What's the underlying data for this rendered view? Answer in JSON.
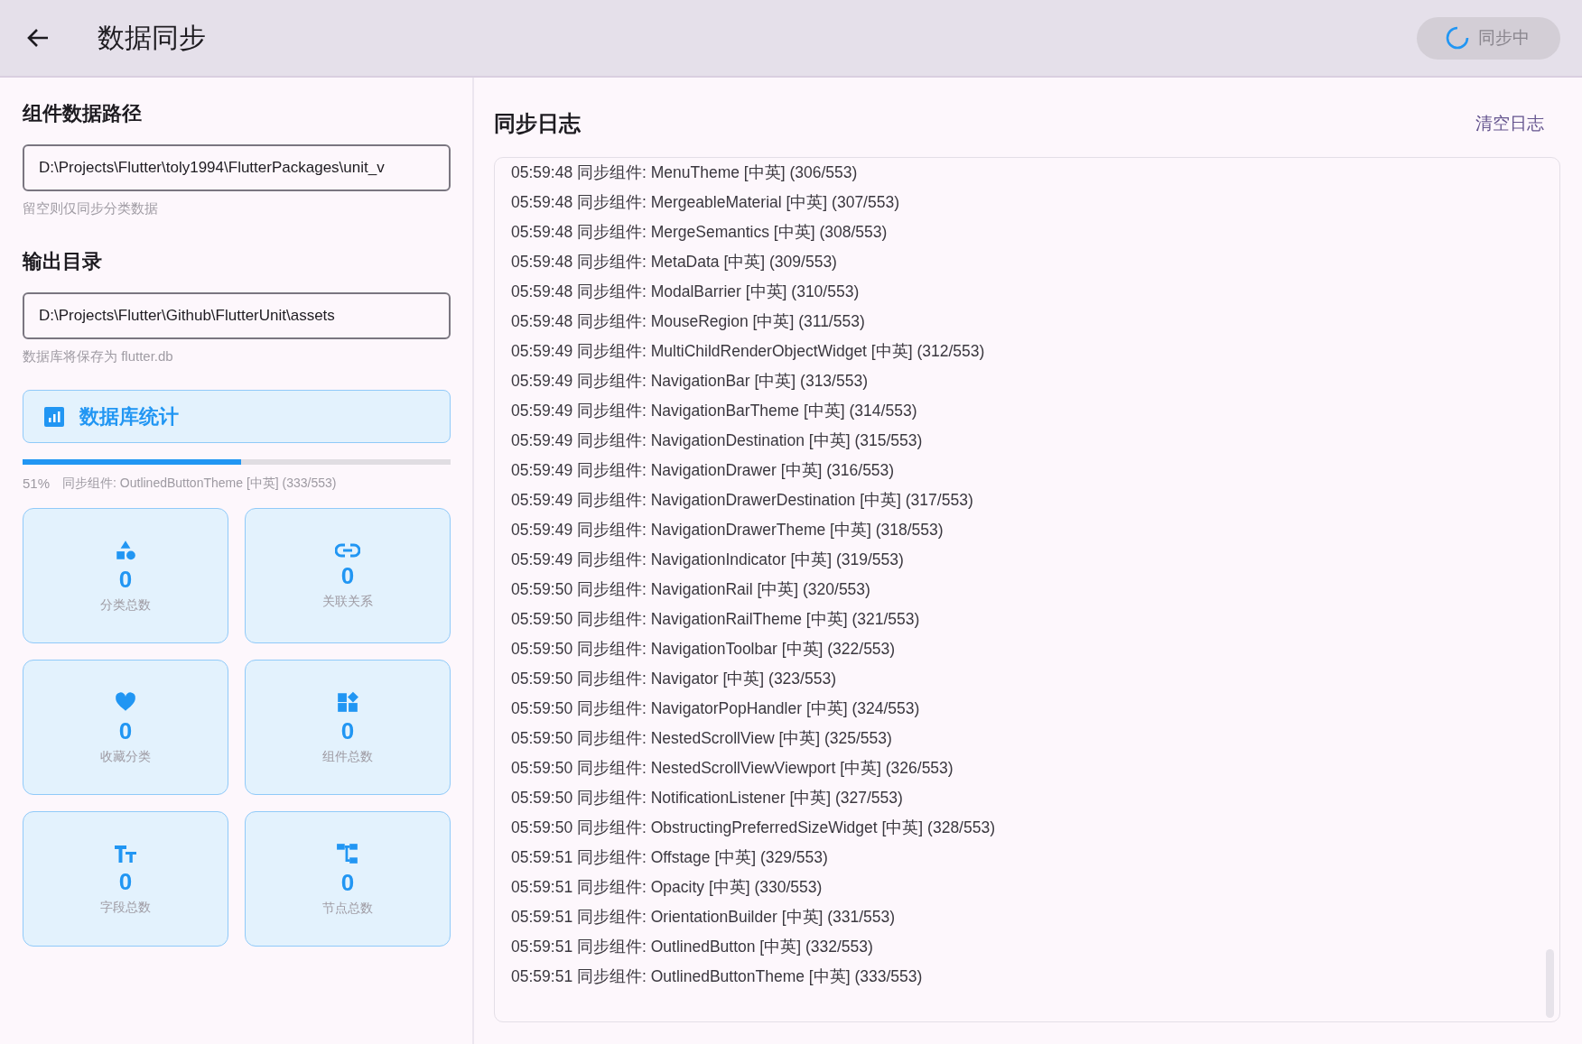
{
  "app_bar": {
    "title": "数据同步",
    "sync_button": {
      "label": "同步中",
      "disabled": true
    }
  },
  "left_panel": {
    "component_path": {
      "label": "组件数据路径",
      "value": "D:\\Projects\\Flutter\\toly1994\\FlutterPackages\\unit_v",
      "hint": "留空则仅同步分类数据"
    },
    "output_dir": {
      "label": "输出目录",
      "value": "D:\\Projects\\Flutter\\Github\\FlutterUnit\\assets",
      "hint": "数据库将保存为 flutter.db"
    },
    "stats_button": {
      "label": "数据库统计"
    },
    "progress": {
      "level": 0.51,
      "percent": "51%",
      "message": "同步组件: OutlinedButtonTheme [中英] (333/553)"
    },
    "stat_cards": [
      {
        "value": "0",
        "label": "分类总数"
      },
      {
        "value": "0",
        "label": "关联关系"
      },
      {
        "value": "0",
        "label": "收藏分类"
      },
      {
        "value": "0",
        "label": "组件总数"
      },
      {
        "value": "0",
        "label": "字段总数"
      },
      {
        "value": "0",
        "label": "节点总数"
      }
    ]
  },
  "log_panel": {
    "title": "同步日志",
    "clear_button": "清空日志",
    "lines": [
      "05:59:48 同步组件: MenuTheme [中英] (306/553)",
      "05:59:48 同步组件: MergeableMaterial [中英] (307/553)",
      "05:59:48 同步组件: MergeSemantics [中英] (308/553)",
      "05:59:48 同步组件: MetaData [中英] (309/553)",
      "05:59:48 同步组件: ModalBarrier [中英] (310/553)",
      "05:59:48 同步组件: MouseRegion [中英] (311/553)",
      "05:59:49 同步组件: MultiChildRenderObjectWidget [中英] (312/553)",
      "05:59:49 同步组件: NavigationBar [中英] (313/553)",
      "05:59:49 同步组件: NavigationBarTheme [中英] (314/553)",
      "05:59:49 同步组件: NavigationDestination [中英] (315/553)",
      "05:59:49 同步组件: NavigationDrawer [中英] (316/553)",
      "05:59:49 同步组件: NavigationDrawerDestination [中英] (317/553)",
      "05:59:49 同步组件: NavigationDrawerTheme [中英] (318/553)",
      "05:59:49 同步组件: NavigationIndicator [中英] (319/553)",
      "05:59:50 同步组件: NavigationRail [中英] (320/553)",
      "05:59:50 同步组件: NavigationRailTheme [中英] (321/553)",
      "05:59:50 同步组件: NavigationToolbar [中英] (322/553)",
      "05:59:50 同步组件: Navigator [中英] (323/553)",
      "05:59:50 同步组件: NavigatorPopHandler [中英] (324/553)",
      "05:59:50 同步组件: NestedScrollView [中英] (325/553)",
      "05:59:50 同步组件: NestedScrollViewViewport [中英] (326/553)",
      "05:59:50 同步组件: NotificationListener [中英] (327/553)",
      "05:59:50 同步组件: ObstructingPreferredSizeWidget [中英] (328/553)",
      "05:59:51 同步组件: Offstage [中英] (329/553)",
      "05:59:51 同步组件: Opacity [中英] (330/553)",
      "05:59:51 同步组件: OrientationBuilder [中英] (331/553)",
      "05:59:51 同步组件: OutlinedButton [中英] (332/553)",
      "05:59:51 同步组件: OutlinedButtonTheme [中英] (333/553)"
    ]
  }
}
